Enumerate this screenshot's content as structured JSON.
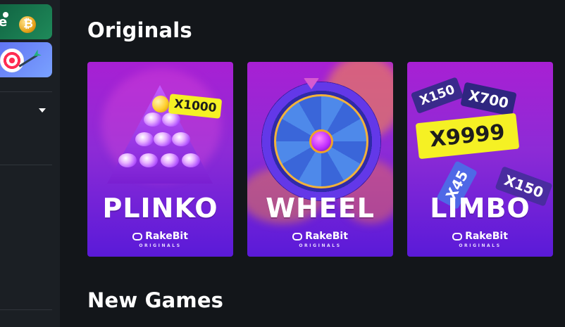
{
  "sidebar": {
    "thumb1_text": "e",
    "dropdown_icon": "chevron-down-icon"
  },
  "sections": {
    "originals": "Originals",
    "new_games": "New Games"
  },
  "cards": [
    {
      "title": "PLINKO",
      "multiplier": "X1000",
      "brand": "RakeBit",
      "sub": "ORIGINALS"
    },
    {
      "title": "WHEEL",
      "brand": "RakeBit",
      "sub": "ORIGINALS"
    },
    {
      "title": "LIMBO",
      "multipliers": [
        "X9999",
        "X700",
        "X150",
        "X150",
        "X45"
      ],
      "brand": "RakeBit",
      "sub": "ORIGINALS"
    }
  ],
  "colors": {
    "page_bg": "#13161a",
    "sidebar_bg": "#1b1f24",
    "card_purple": "#8d2bd6",
    "highlight_yellow": "#f5f124"
  }
}
